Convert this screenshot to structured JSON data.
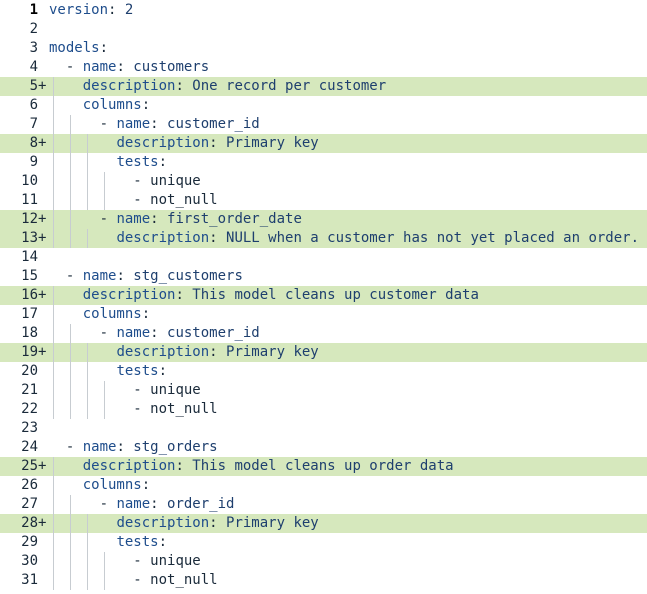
{
  "editor": {
    "language": "yaml",
    "lines": [
      {
        "num": "1",
        "marker": "",
        "added": false,
        "indent": 0,
        "guides": 0,
        "key": "version",
        "sep": ": ",
        "value": "2"
      },
      {
        "num": "2",
        "marker": "",
        "added": false,
        "indent": 0,
        "guides": 0,
        "key": "",
        "sep": "",
        "value": ""
      },
      {
        "num": "3",
        "marker": "",
        "added": false,
        "indent": 0,
        "guides": 0,
        "key": "models",
        "sep": ":",
        "value": ""
      },
      {
        "num": "4",
        "marker": "",
        "added": false,
        "indent": 2,
        "guides": 0,
        "dash": "- ",
        "key": "name",
        "sep": ": ",
        "value": "customers"
      },
      {
        "num": "5",
        "marker": "+",
        "added": true,
        "indent": 4,
        "guides": 1,
        "key": "description",
        "sep": ": ",
        "value": "One record per customer"
      },
      {
        "num": "6",
        "marker": "",
        "added": false,
        "indent": 4,
        "guides": 1,
        "key": "columns",
        "sep": ":",
        "value": ""
      },
      {
        "num": "7",
        "marker": "",
        "added": false,
        "indent": 6,
        "guides": 2,
        "dash": "- ",
        "key": "name",
        "sep": ": ",
        "value": "customer_id"
      },
      {
        "num": "8",
        "marker": "+",
        "added": true,
        "indent": 8,
        "guides": 3,
        "key": "description",
        "sep": ": ",
        "value": "Primary key"
      },
      {
        "num": "9",
        "marker": "",
        "added": false,
        "indent": 8,
        "guides": 3,
        "key": "tests",
        "sep": ":",
        "value": ""
      },
      {
        "num": "10",
        "marker": "",
        "added": false,
        "indent": 10,
        "guides": 4,
        "dash": "- ",
        "key": "",
        "sep": "",
        "value": "unique"
      },
      {
        "num": "11",
        "marker": "",
        "added": false,
        "indent": 10,
        "guides": 4,
        "dash": "- ",
        "key": "",
        "sep": "",
        "value": "not_null"
      },
      {
        "num": "12",
        "marker": "+",
        "added": true,
        "indent": 6,
        "guides": 2,
        "dash": "- ",
        "key": "name",
        "sep": ": ",
        "value": "first_order_date"
      },
      {
        "num": "13",
        "marker": "+",
        "added": true,
        "indent": 8,
        "guides": 3,
        "key": "description",
        "sep": ": ",
        "value": "NULL when a customer has not yet placed an order."
      },
      {
        "num": "14",
        "marker": "",
        "added": false,
        "indent": 0,
        "guides": 0,
        "key": "",
        "sep": "",
        "value": ""
      },
      {
        "num": "15",
        "marker": "",
        "added": false,
        "indent": 2,
        "guides": 0,
        "dash": "- ",
        "key": "name",
        "sep": ": ",
        "value": "stg_customers"
      },
      {
        "num": "16",
        "marker": "+",
        "added": true,
        "indent": 4,
        "guides": 1,
        "key": "description",
        "sep": ": ",
        "value": "This model cleans up customer data"
      },
      {
        "num": "17",
        "marker": "",
        "added": false,
        "indent": 4,
        "guides": 1,
        "key": "columns",
        "sep": ":",
        "value": ""
      },
      {
        "num": "18",
        "marker": "",
        "added": false,
        "indent": 6,
        "guides": 2,
        "dash": "- ",
        "key": "name",
        "sep": ": ",
        "value": "customer_id"
      },
      {
        "num": "19",
        "marker": "+",
        "added": true,
        "indent": 8,
        "guides": 3,
        "key": "description",
        "sep": ": ",
        "value": "Primary key"
      },
      {
        "num": "20",
        "marker": "",
        "added": false,
        "indent": 8,
        "guides": 3,
        "key": "tests",
        "sep": ":",
        "value": ""
      },
      {
        "num": "21",
        "marker": "",
        "added": false,
        "indent": 10,
        "guides": 4,
        "dash": "- ",
        "key": "",
        "sep": "",
        "value": "unique"
      },
      {
        "num": "22",
        "marker": "",
        "added": false,
        "indent": 10,
        "guides": 4,
        "dash": "- ",
        "key": "",
        "sep": "",
        "value": "not_null"
      },
      {
        "num": "23",
        "marker": "",
        "added": false,
        "indent": 0,
        "guides": 0,
        "key": "",
        "sep": "",
        "value": ""
      },
      {
        "num": "24",
        "marker": "",
        "added": false,
        "indent": 2,
        "guides": 0,
        "dash": "- ",
        "key": "name",
        "sep": ": ",
        "value": "stg_orders"
      },
      {
        "num": "25",
        "marker": "+",
        "added": true,
        "indent": 4,
        "guides": 1,
        "key": "description",
        "sep": ": ",
        "value": "This model cleans up order data"
      },
      {
        "num": "26",
        "marker": "",
        "added": false,
        "indent": 4,
        "guides": 1,
        "key": "columns",
        "sep": ":",
        "value": ""
      },
      {
        "num": "27",
        "marker": "",
        "added": false,
        "indent": 6,
        "guides": 2,
        "dash": "- ",
        "key": "name",
        "sep": ": ",
        "value": "order_id"
      },
      {
        "num": "28",
        "marker": "+",
        "added": true,
        "indent": 8,
        "guides": 3,
        "key": "description",
        "sep": ": ",
        "value": "Primary key"
      },
      {
        "num": "29",
        "marker": "",
        "added": false,
        "indent": 8,
        "guides": 3,
        "key": "tests",
        "sep": ":",
        "value": ""
      },
      {
        "num": "30",
        "marker": "",
        "added": false,
        "indent": 10,
        "guides": 4,
        "dash": "- ",
        "key": "",
        "sep": "",
        "value": "unique"
      },
      {
        "num": "31",
        "marker": "",
        "added": false,
        "indent": 10,
        "guides": 4,
        "dash": "- ",
        "key": "",
        "sep": "",
        "value": "not_null"
      }
    ]
  },
  "colors": {
    "added_line_bg": "#d6e8bd",
    "key": "#1e4d8c",
    "value": "#1e3f6e",
    "line_number": "#1a2a3a",
    "indent_guide": "#c7ccd1"
  }
}
